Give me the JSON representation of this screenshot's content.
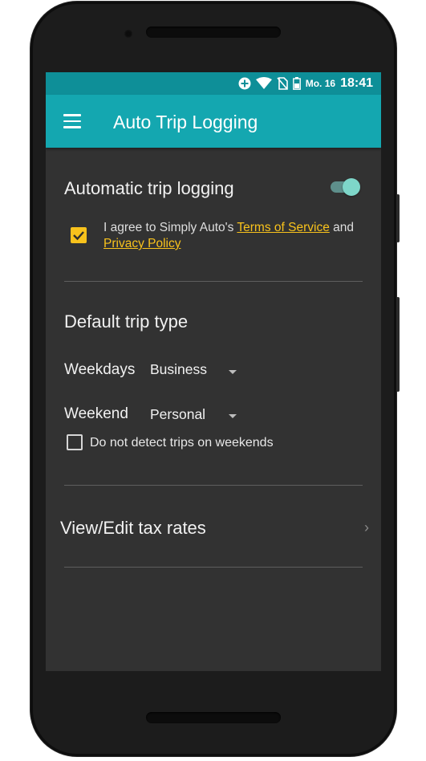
{
  "status_bar": {
    "day": "Mo. 16",
    "time": "18:41",
    "icons": [
      "data-saver-icon",
      "wifi-icon",
      "no-sim-icon",
      "battery-icon"
    ]
  },
  "toolbar": {
    "title": "Auto Trip Logging",
    "menu_icon": "hamburger-menu-icon"
  },
  "auto_logging": {
    "label": "Automatic trip logging",
    "enabled": true
  },
  "consent": {
    "checked": true,
    "text_prefix": "I agree to Simply Auto's ",
    "terms_link": "Terms of Service",
    "text_middle": " and",
    "privacy_link": "Privacy Policy"
  },
  "default_trip": {
    "heading": "Default trip type",
    "weekdays_label": "Weekdays",
    "weekdays_value": "Business",
    "weekend_label": "Weekend",
    "weekend_value": "Personal"
  },
  "weekend_option": {
    "label": "Do not detect trips on weekends",
    "checked": false
  },
  "tax_rates": {
    "label": "View/Edit tax rates"
  },
  "colors": {
    "status_bar": "#0e8f98",
    "toolbar": "#14a7b0",
    "background": "#323232",
    "accent": "#f8c21c",
    "toggle": "#7ed6c9"
  }
}
